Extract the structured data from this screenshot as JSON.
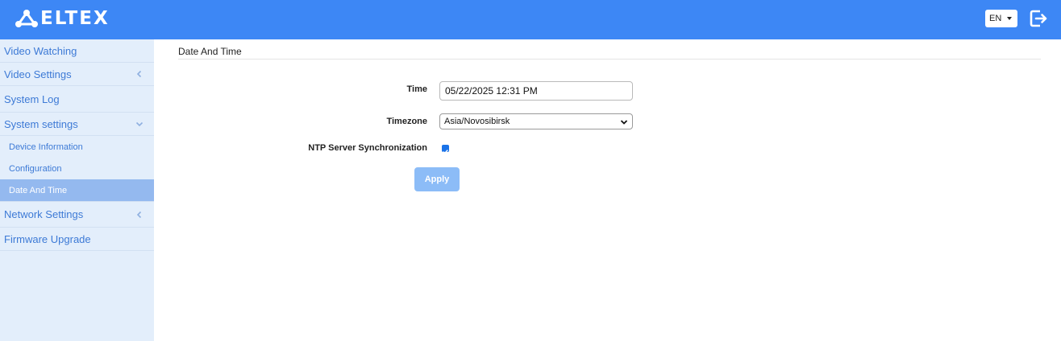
{
  "header": {
    "brand": "ELTEX",
    "language": "EN",
    "logout_icon": "logout-icon",
    "color": "#3d87f5"
  },
  "sidebar": {
    "items": [
      {
        "label": "Video Watching"
      },
      {
        "label": "Video Settings",
        "icon": "chevron-left-icon"
      },
      {
        "label": "System Log"
      },
      {
        "label": "System settings",
        "icon": "chevron-down-icon"
      }
    ],
    "subitems": [
      {
        "label": "Device Information"
      },
      {
        "label": "Configuration"
      },
      {
        "label": "Date And Time",
        "active": true
      }
    ],
    "items_after": [
      {
        "label": "Network Settings",
        "icon": "chevron-left-icon"
      },
      {
        "label": "Firmware Upgrade"
      }
    ]
  },
  "main": {
    "title": "Date And Time",
    "form": {
      "time_label": "Time",
      "time_value": "05/22/2025 12:31 PM",
      "timezone_label": "Timezone",
      "timezone_value": "Asia/Novosibirsk",
      "ntp_label": "NTP Server Synchronization",
      "ntp_checked": true,
      "apply_label": "Apply"
    }
  }
}
